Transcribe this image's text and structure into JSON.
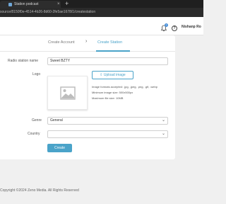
{
  "browser": {
    "tab_title": "Station podcast",
    "tab_close": "×",
    "new_tab": "+",
    "address": "source/8150f0e-4514-4b26-8d60-2fe5ae1678/1/createstation"
  },
  "header": {
    "notification_count": "1",
    "help_label": "?",
    "username": "Nishanp Ro"
  },
  "steps": {
    "step1": "Create Account",
    "separator": "›",
    "step2": "Create Station"
  },
  "form": {
    "station_name_label": "Radio station name",
    "station_name_value": "Sweet BZTY",
    "logo_label": "Logo",
    "upload_label": "Upload image",
    "hint_formats": "Image formats accepted: .jpg, .jpeg, .png, .gif, .webp",
    "hint_min_size": "Minimum image size: 500x500px",
    "hint_max_file": "Maximum file size: 10MB",
    "genre_label": "Genre",
    "genre_value": "General",
    "country_label": "Country",
    "country_value": "",
    "create_label": "Create"
  },
  "footer": {
    "copyright": "Copyright ©2024 Zeno Media. All Rights Reserved"
  },
  "colors": {
    "accent": "#4aa3c9",
    "background": "#f0f0f0",
    "card": "#ffffff"
  }
}
